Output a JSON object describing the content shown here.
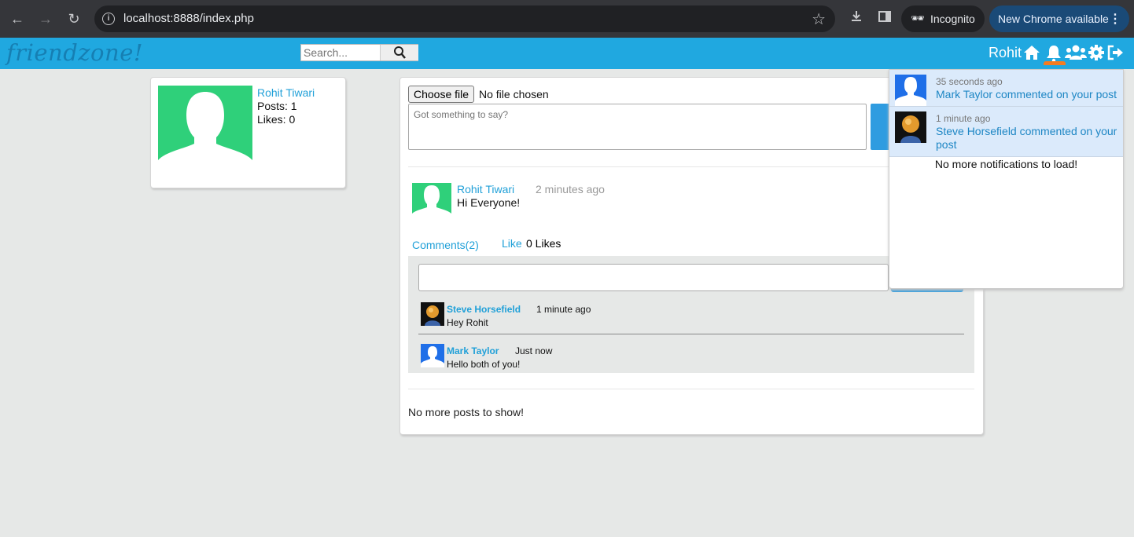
{
  "browser": {
    "url": "localhost:8888/index.php",
    "incognito_label": "Incognito",
    "update_label": "New Chrome available"
  },
  "header": {
    "logo": "friendzone!",
    "search_placeholder": "Search...",
    "username": "Rohit"
  },
  "profile": {
    "name": "Rohit Tiwari",
    "posts": "Posts: 1",
    "likes": "Likes: 0"
  },
  "composer": {
    "file_button": "Choose file",
    "file_status": "No file chosen",
    "placeholder": "Got something to say?"
  },
  "post": {
    "author": "Rohit Tiwari",
    "time": "2 minutes ago",
    "body": "Hi Everyone!",
    "comments_link": "Comments(2)",
    "like_link": "Like",
    "like_count": "0 Likes",
    "comments": [
      {
        "author": "Steve Horsefield",
        "time": "1 minute ago",
        "text": "Hey Rohit"
      },
      {
        "author": "Mark Taylor",
        "time": "Just now",
        "text": "Hello both of you!"
      }
    ]
  },
  "feed_end": "No more posts to show!",
  "notifications": {
    "items": [
      {
        "time": "35 seconds ago",
        "text": "Mark Taylor commented on your post"
      },
      {
        "time": "1 minute ago",
        "text": "Steve Horsefield commented on your post"
      }
    ],
    "end_text": "No more notifications to load!"
  },
  "colors": {
    "brand": "#20a8e0",
    "link": "#20a0d8",
    "avatar_green": "#2fd07a",
    "notification_bg": "#dbeafb",
    "badge_orange": "#f47c20"
  }
}
